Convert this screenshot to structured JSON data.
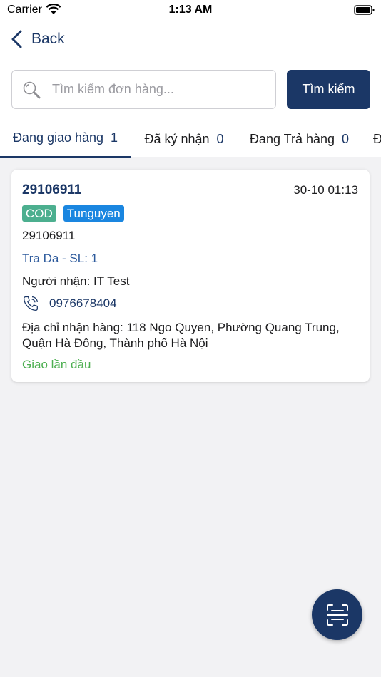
{
  "status_bar": {
    "carrier": "Carrier",
    "time": "1:13 AM"
  },
  "nav": {
    "back_label": "Back"
  },
  "search": {
    "placeholder": "Tìm kiếm đơn hàng...",
    "value": "",
    "button_label": "Tìm kiếm"
  },
  "tabs": [
    {
      "label": "Đang giao hàng",
      "count": "1",
      "active": true
    },
    {
      "label": "Đã ký nhận",
      "count": "0",
      "active": false
    },
    {
      "label": "Đang Trả hàng",
      "count": "0",
      "active": false
    },
    {
      "label": "Đ",
      "count": "",
      "active": false
    }
  ],
  "order": {
    "code": "29106911",
    "datetime": "30-10 01:13",
    "tags": [
      "COD",
      "Tunguyen"
    ],
    "sub_code": "29106911",
    "product": "Tra Da - SL: 1",
    "receiver": "Người nhận: IT Test",
    "phone": "0976678404",
    "address": "Địa chỉ nhận hàng: 118 Ngo Quyen, Phường Quang Trung, Quận Hà Đông, Thành phố Hà Nội",
    "delivery_status": "Giao lần đầu"
  },
  "colors": {
    "primary": "#1b3766",
    "tag_cod": "#4caf8f",
    "tag_user": "#1a86e0",
    "status_green": "#4caf50",
    "background": "#f2f2f4"
  },
  "icons": {
    "search": "search-icon",
    "phone": "phone-icon",
    "scan": "scan-icon",
    "back": "chevron-left-icon"
  }
}
